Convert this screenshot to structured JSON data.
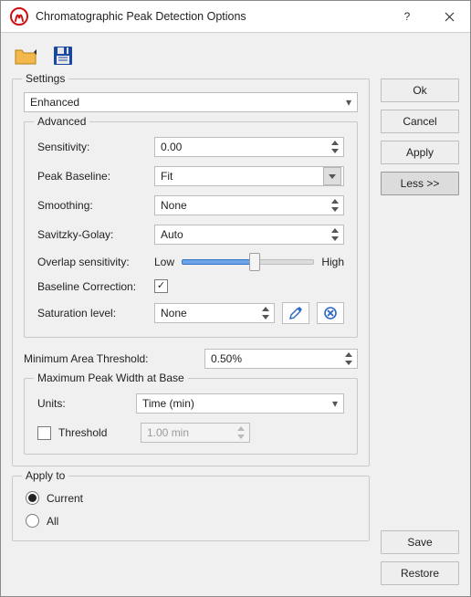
{
  "title": "Chromatographic Peak Detection Options",
  "settings": {
    "legend": "Settings",
    "preset": "Enhanced",
    "advanced": {
      "legend": "Advanced",
      "sensitivity": {
        "label": "Sensitivity:",
        "value": "0.00"
      },
      "peak_baseline": {
        "label": "Peak Baseline:",
        "value": "Fit"
      },
      "smoothing": {
        "label": "Smoothing:",
        "value": "None"
      },
      "savitzky_golay": {
        "label": "Savitzky-Golay:",
        "value": "Auto"
      },
      "overlap": {
        "label": "Overlap sensitivity:",
        "low": "Low",
        "high": "High"
      },
      "baseline_correction": {
        "label": "Baseline Correction:",
        "checked": true
      },
      "saturation": {
        "label": "Saturation level:",
        "value": "None"
      }
    },
    "min_area": {
      "label": "Minimum Area Threshold:",
      "value": "0.50%"
    },
    "max_width": {
      "legend": "Maximum Peak Width at Base",
      "units": {
        "label": "Units:",
        "value": "Time (min)"
      },
      "threshold": {
        "label": "Threshold",
        "value": "1.00 min",
        "checked": false
      }
    }
  },
  "apply_to": {
    "legend": "Apply to",
    "options": [
      "Current",
      "All"
    ],
    "selected": "Current"
  },
  "buttons": {
    "ok": "Ok",
    "cancel": "Cancel",
    "apply": "Apply",
    "less": "Less >>",
    "save": "Save",
    "restore": "Restore"
  }
}
